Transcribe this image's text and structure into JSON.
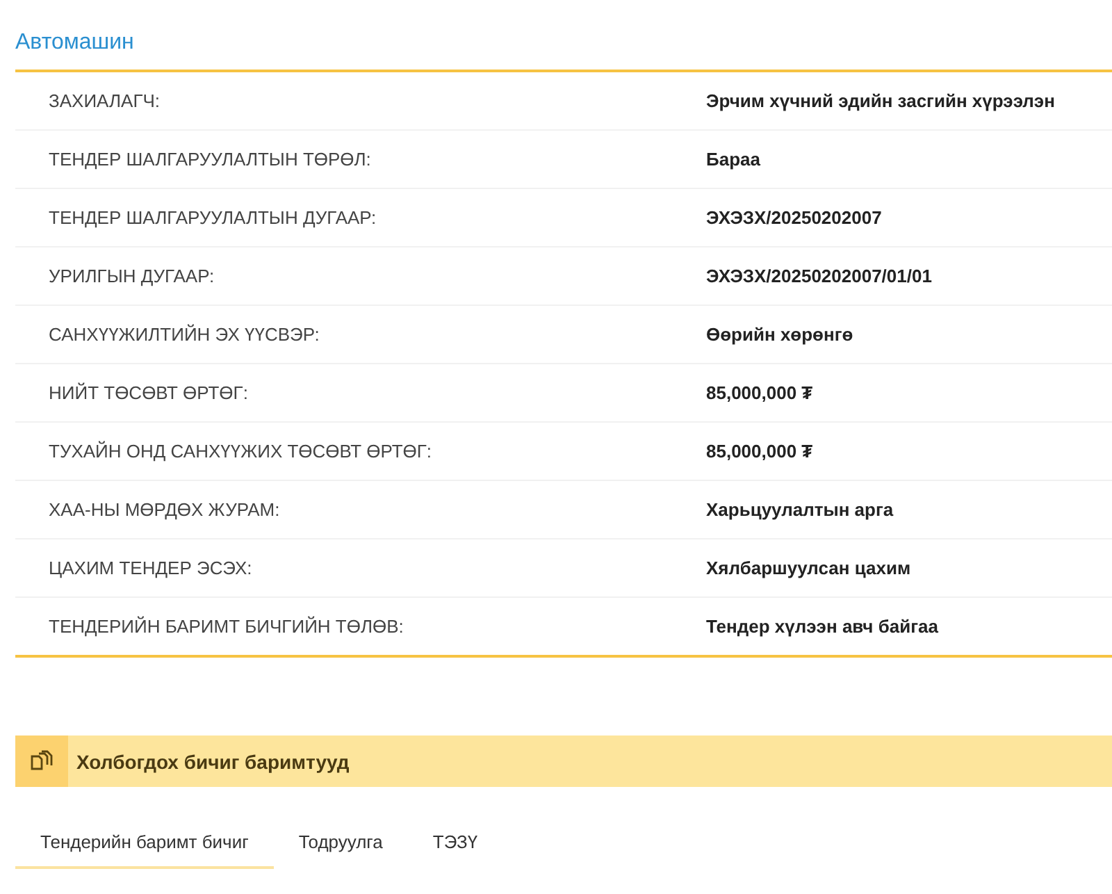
{
  "title": "Автомашин",
  "details": [
    {
      "label": "ЗАХИАЛАГЧ:",
      "value": "Эрчим хүчний эдийн засгийн хүрээлэн"
    },
    {
      "label": "ТЕНДЕР ШАЛГАРУУЛАЛТЫН ТӨРӨЛ:",
      "value": "Бараа"
    },
    {
      "label": "ТЕНДЕР ШАЛГАРУУЛАЛТЫН ДУГААР:",
      "value": "ЭХЭЗХ/20250202007"
    },
    {
      "label": "УРИЛГЫН ДУГААР:",
      "value": "ЭХЭЗХ/20250202007/01/01"
    },
    {
      "label": "САНХҮҮЖИЛТИЙН ЭХ ҮҮСВЭР:",
      "value": "Өөрийн хөрөнгө"
    },
    {
      "label": "НИЙТ ТӨСӨВТ ӨРТӨГ:",
      "value": "85,000,000 ₮"
    },
    {
      "label": "ТУХАЙН ОНД САНХҮҮЖИХ ТӨСӨВТ ӨРТӨГ:",
      "value": "85,000,000 ₮"
    },
    {
      "label": "ХАА-НЫ МӨРДӨХ ЖУРАМ:",
      "value": "Харьцуулалтын арга"
    },
    {
      "label": "ЦАХИМ ТЕНДЕР ЭСЭХ:",
      "value": "Хялбаршуулсан цахим"
    },
    {
      "label": "ТЕНДЕРИЙН БАРИМТ БИЧГИЙН ТӨЛӨВ:",
      "value": "Тендер хүлээн авч байгаа"
    }
  ],
  "documents": {
    "title": "Холбогдох бичиг баримтууд",
    "tabs": [
      {
        "label": "Тендерийн баримт бичиг",
        "selected": true
      },
      {
        "label": "Тодруулга",
        "selected": false
      },
      {
        "label": "ТЭЗҮ",
        "selected": false
      }
    ]
  }
}
